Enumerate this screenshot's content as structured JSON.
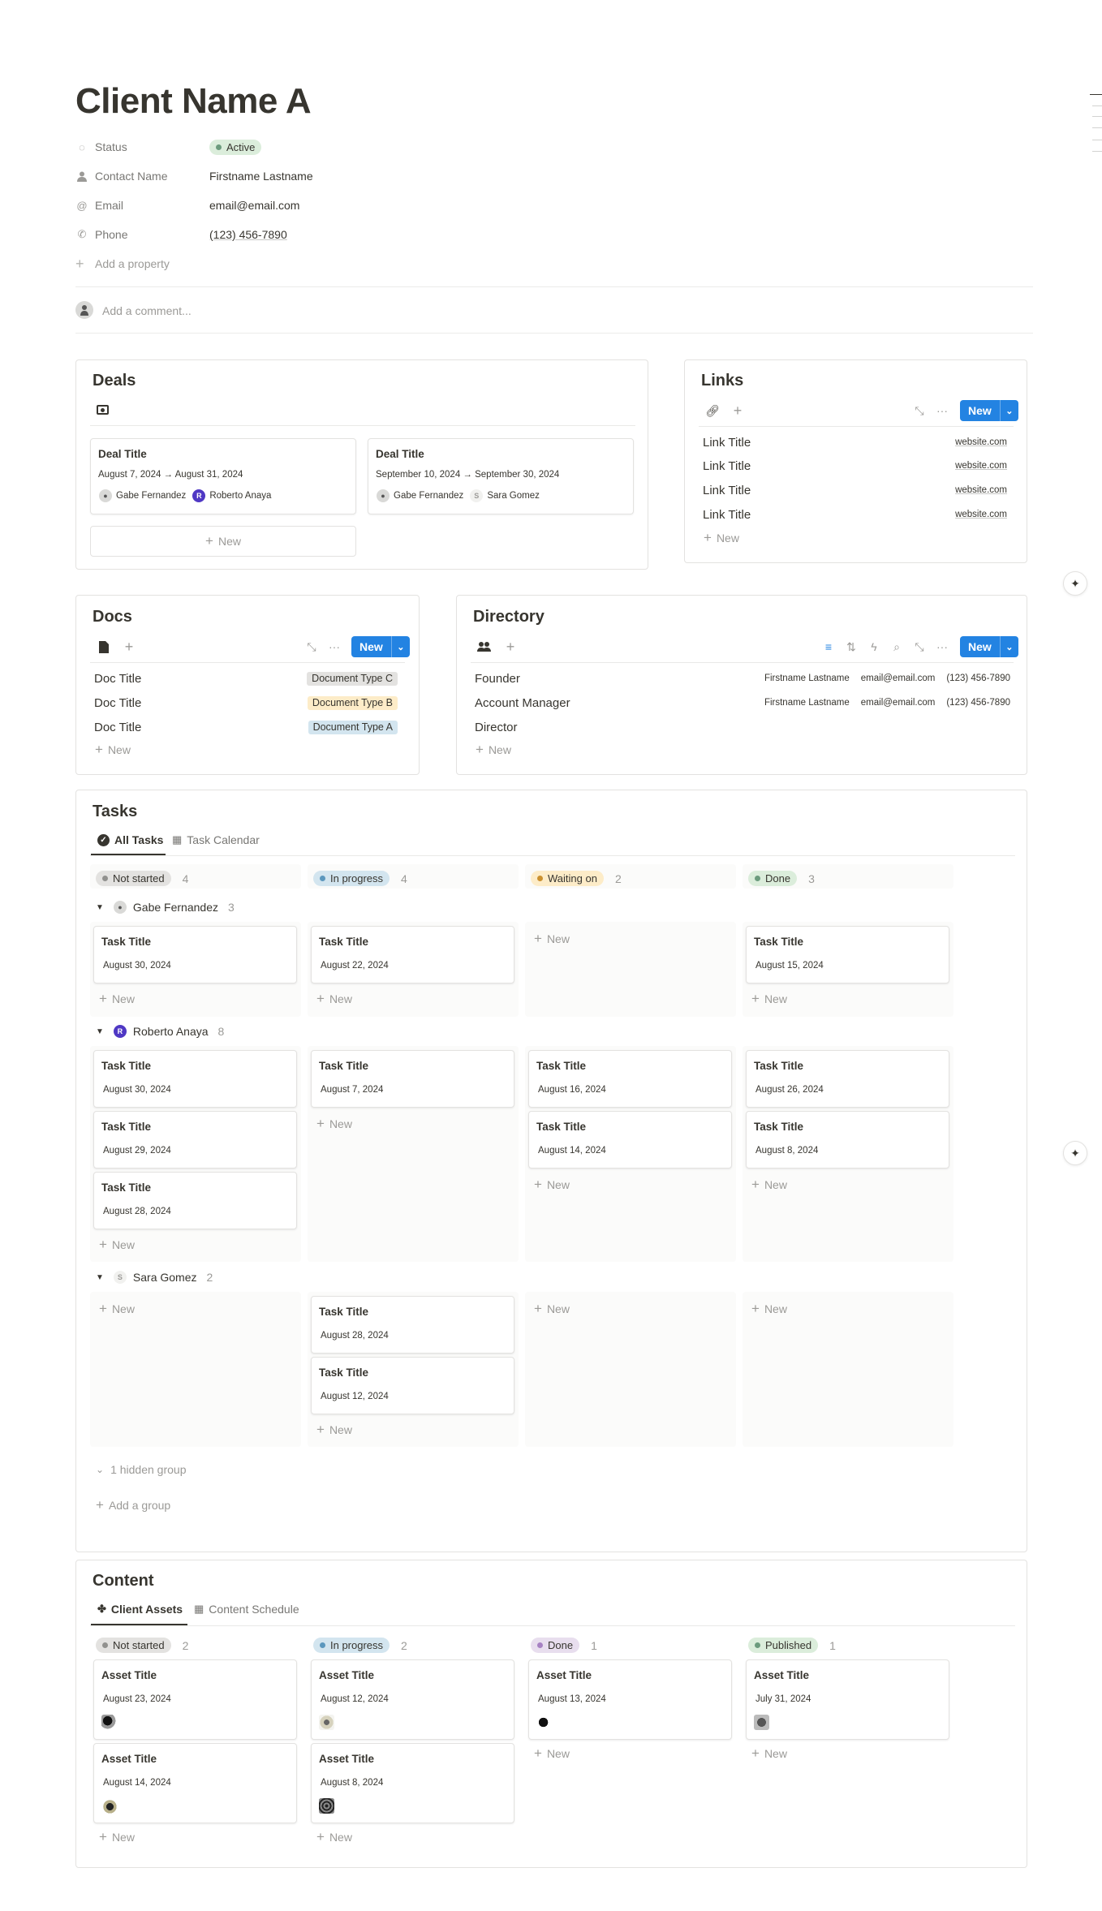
{
  "page": {
    "title": "Client Name A",
    "properties": [
      {
        "key": "Status",
        "icon": "status-icon",
        "value": "Active",
        "color": "#dbeddb",
        "dot": "#6c9b7d"
      },
      {
        "key": "Contact Name",
        "icon": "person-icon",
        "value": "Firstname Lastname"
      },
      {
        "key": "Email",
        "icon": "at-icon",
        "value": "email@email.com"
      },
      {
        "key": "Phone",
        "icon": "phone-icon",
        "value": "(123) 456-7890"
      }
    ],
    "add_property": "Add a property",
    "comment_placeholder": "Add a comment..."
  },
  "deals": {
    "title": "Deals",
    "items": [
      {
        "title": "Deal Title",
        "dates": "August 7, 2024 → August 31, 2024",
        "people": [
          "Gabe Fernandez",
          "Roberto Anaya"
        ]
      },
      {
        "title": "Deal Title",
        "dates": "September 10, 2024 → September 30, 2024",
        "people": [
          "Gabe Fernandez",
          "Sara Gomez"
        ]
      }
    ],
    "new_label": "New"
  },
  "links": {
    "title": "Links",
    "new_button": "New",
    "rows": [
      {
        "title": "Link Title",
        "url": "website.com"
      },
      {
        "title": "Link Title",
        "url": "website.com"
      },
      {
        "title": "Link Title",
        "url": "website.com"
      },
      {
        "title": "Link Title",
        "url": "website.com"
      }
    ],
    "new_label": "New"
  },
  "docs": {
    "title": "Docs",
    "new_button": "New",
    "rows": [
      {
        "title": "Doc Title",
        "type": "Document Type C",
        "color": "#e3e2e0"
      },
      {
        "title": "Doc Title",
        "type": "Document Type B",
        "color": "#fdecc8"
      },
      {
        "title": "Doc Title",
        "type": "Document Type A",
        "color": "#d3e5ef"
      }
    ],
    "new_label": "New"
  },
  "directory": {
    "title": "Directory",
    "new_button": "New",
    "rows": [
      {
        "role": "Founder",
        "name": "Firstname Lastname",
        "email": "email@email.com",
        "phone": "(123) 456-7890"
      },
      {
        "role": "Account Manager",
        "name": "Firstname Lastname",
        "email": "email@email.com",
        "phone": "(123) 456-7890"
      },
      {
        "role": "Director",
        "name": "",
        "email": "",
        "phone": ""
      }
    ],
    "new_label": "New"
  },
  "tasks": {
    "title": "Tasks",
    "tabs": [
      "All Tasks",
      "Task Calendar"
    ],
    "columns": [
      {
        "label": "Not started",
        "count": "4",
        "bg": "#e3e2e0",
        "dot": "#91918e"
      },
      {
        "label": "In progress",
        "count": "4",
        "bg": "#d3e5ef",
        "dot": "#5b97bd"
      },
      {
        "label": "Waiting on",
        "count": "2",
        "bg": "#fdecc8",
        "dot": "#cb912f"
      },
      {
        "label": "Done",
        "count": "3",
        "bg": "#dbeddb",
        "dot": "#6c9b7d"
      }
    ],
    "groups": [
      {
        "name": "Gabe Fernandez",
        "count": "3",
        "avatar": ""
      },
      {
        "name": "Roberto Anaya",
        "count": "8",
        "avatar": "R"
      },
      {
        "name": "Sara Gomez",
        "count": "2",
        "avatar": "S"
      }
    ],
    "card_title": "Task Title",
    "dates": {
      "g1c1": "August 30, 2024",
      "g1c2": "August 22, 2024",
      "g1c4": "August 15, 2024",
      "g2c1a": "August 30, 2024",
      "g2c1b": "August 29, 2024",
      "g2c1c": "August 28, 2024",
      "g2c2a": "August 7, 2024",
      "g2c3a": "August 16, 2024",
      "g2c3b": "August 14, 2024",
      "g2c4a": "August 26, 2024",
      "g2c4b": "August 8, 2024",
      "g3c2a": "August 28, 2024",
      "g3c2b": "August 12, 2024"
    },
    "new_label": "New",
    "hidden_group": "1 hidden group",
    "add_group": "Add a group"
  },
  "content": {
    "title": "Content",
    "tabs": [
      "Client Assets",
      "Content Schedule"
    ],
    "columns": [
      {
        "label": "Not started",
        "count": "2",
        "bg": "#e3e2e0",
        "dot": "#91918e"
      },
      {
        "label": "In progress",
        "count": "2",
        "bg": "#d3e5ef",
        "dot": "#5b97bd"
      },
      {
        "label": "Done",
        "count": "1",
        "bg": "#e8deee",
        "dot": "#a782c3"
      },
      {
        "label": "Published",
        "count": "1",
        "bg": "#dbeddb",
        "dot": "#6c9b7d"
      }
    ],
    "card_title": "Asset Title",
    "dates": {
      "c1a": "August 23, 2024",
      "c1b": "August 14, 2024",
      "c2a": "August 12, 2024",
      "c2b": "August 8, 2024",
      "c3a": "August 13, 2024",
      "c4a": "July 31, 2024"
    },
    "new_label": "New"
  }
}
